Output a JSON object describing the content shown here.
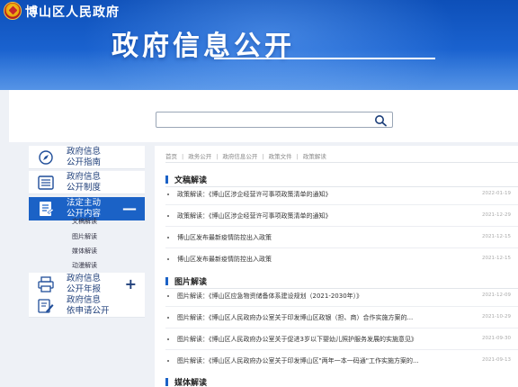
{
  "header": {
    "site_name": "博山区人民政府",
    "main_title": "政府信息公开"
  },
  "search": {
    "placeholder": "",
    "value": ""
  },
  "sidebar": {
    "items": [
      {
        "line1": "政府信息",
        "line2": "公开指南",
        "icon": "compass-icon"
      },
      {
        "line1": "政府信息",
        "line2": "公开制度",
        "icon": "list-icon"
      },
      {
        "line1": "法定主动",
        "line2": "公开内容",
        "icon": "document-icon",
        "sign": "—"
      },
      {
        "line1": "政府信息",
        "line2": "公开年报",
        "icon": "printer-icon",
        "sign": "+"
      },
      {
        "line1": "政府信息",
        "line2": "依申请公开",
        "icon": "edit-icon"
      }
    ],
    "submenu": [
      "文稿解读",
      "图片解读",
      "媒体解读",
      "动漫解读"
    ]
  },
  "breadcrumb": [
    "首页",
    "政务公开",
    "政府信息公开",
    "政策文件",
    "政策解读"
  ],
  "sections": [
    {
      "title": "文稿解读",
      "rows": [
        {
          "text": "政策解读：《博山区涉企经营许可事项政策清单的通知》",
          "date": "2022-01-19"
        },
        {
          "text": "政策解读：《博山区涉企经营许可事项政策清单的通知》",
          "date": "2021-12-29"
        },
        {
          "text": "博山区发布最新疫情防控出入政策",
          "date": "2021-12-15"
        },
        {
          "text": "博山区发布最新疫情防控出入政策",
          "date": "2021-12-15"
        }
      ]
    },
    {
      "title": "图片解读",
      "rows": [
        {
          "text": "图片解读：《博山区应急物资储备体系建设规划（2021-2030年）》",
          "date": "2021-12-09"
        },
        {
          "text": "图片解读：《博山区人民政府办公室关于印发博山区政银（担、商）合作实施方案的...",
          "date": "2021-10-29"
        },
        {
          "text": "图片解读：《博山区人民政府办公室关于促进3岁以下婴幼儿照护服务发展的实施意见》",
          "date": "2021-09-30"
        },
        {
          "text": "图片解读：《博山区人民政府办公室关于印发博山区\"两年一本一码通\"工作实施方案的...",
          "date": "2021-09-13"
        }
      ]
    },
    {
      "title": "媒体解读",
      "rows": []
    }
  ],
  "colors": {
    "brand_blue": "#1b62c6",
    "banner_blue": "#0d4fb8"
  }
}
